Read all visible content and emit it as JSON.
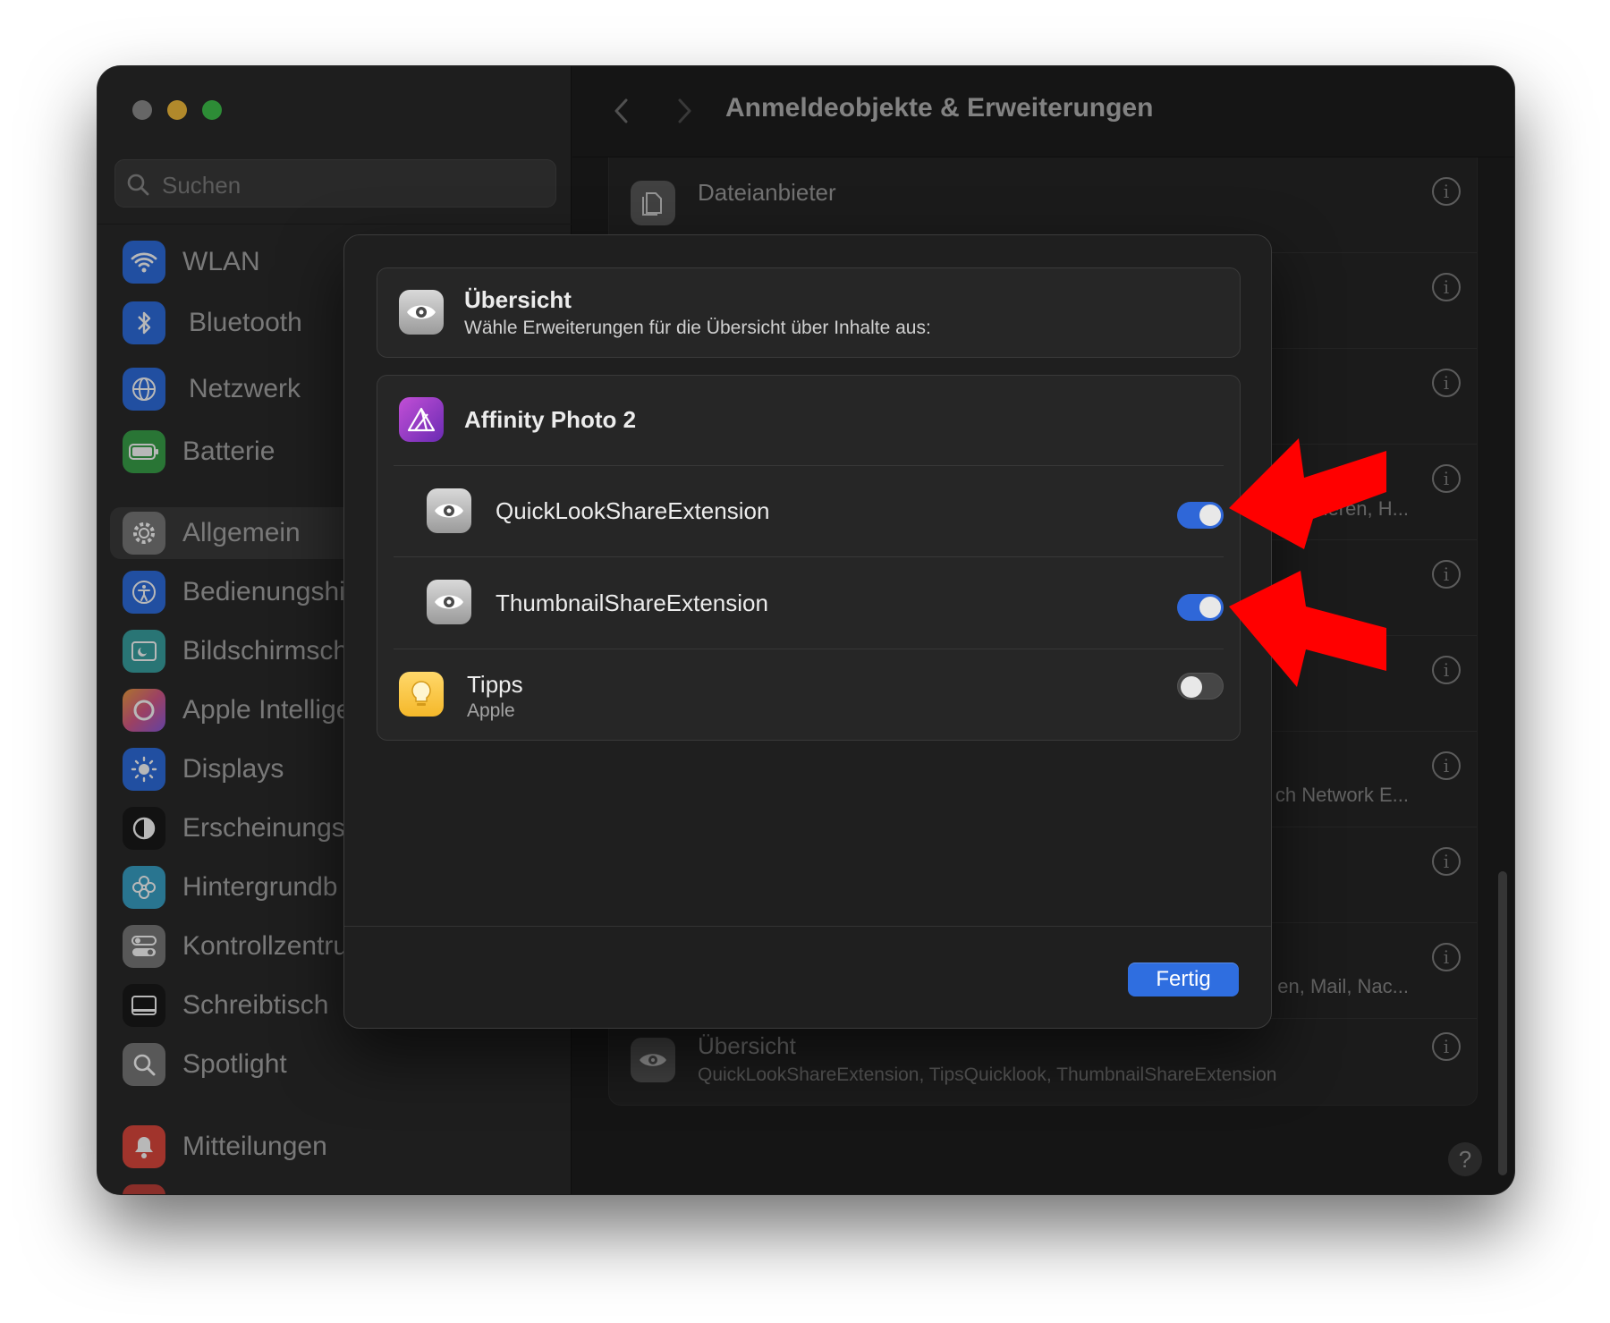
{
  "sidebar": {
    "search_placeholder": "Suchen",
    "items": [
      {
        "label": "WLAN",
        "icon": "wifi-icon",
        "color": "#2f6ee0"
      },
      {
        "label": "Bluetooth",
        "icon": "bluetooth-icon",
        "color": "#2f6ee0"
      },
      {
        "label": "Netzwerk",
        "icon": "globe-icon",
        "color": "#2f6ee0"
      },
      {
        "label": "Batterie",
        "icon": "battery-icon",
        "color": "#3aa34a"
      },
      {
        "label": "Allgemein",
        "icon": "gear-icon",
        "color": "#7a7a7a"
      },
      {
        "label": "Bedienungshi",
        "icon": "accessibility-icon",
        "color": "#2f6ee0"
      },
      {
        "label": "Bildschirmsch",
        "icon": "screensaver-icon",
        "color": "#3aa3a3"
      },
      {
        "label": "Apple Intellige",
        "icon": "apple-intelligence-icon",
        "color": "#d85a8a"
      },
      {
        "label": "Displays",
        "icon": "sun-icon",
        "color": "#2f6ee0"
      },
      {
        "label": "Erscheinungs",
        "icon": "appearance-icon",
        "color": "#1a1a1a"
      },
      {
        "label": "Hintergrundb",
        "icon": "flower-icon",
        "color": "#3aa3c8"
      },
      {
        "label": "Kontrollzentru",
        "icon": "control-center-icon",
        "color": "#7a7a7a"
      },
      {
        "label": "Schreibtisch",
        "icon": "desktop-icon",
        "color": "#1a1a1a"
      },
      {
        "label": "Spotlight",
        "icon": "magnifier-icon",
        "color": "#7a7a7a"
      },
      {
        "label": "Mitteilungen",
        "icon": "bell-icon",
        "color": "#e0483e"
      }
    ]
  },
  "titlebar": {
    "title": "Anmeldeobjekte & Erweiterungen"
  },
  "background_list": {
    "top_row_title": "Dateianbieter",
    "partial_texts": [
      "rtieren, H...",
      "ch Network E...",
      "en, Mail, Nac..."
    ],
    "bottom_row_title": "Übersicht",
    "bottom_row_sub": "QuickLookShareExtension, TipsQuicklook, ThumbnailShareExtension",
    "info_glyph": "i",
    "help_glyph": "?"
  },
  "sheet": {
    "header": {
      "title": "Übersicht",
      "subtitle": "Wähle Erweiterungen für die Übersicht über Inhalte aus:"
    },
    "app": {
      "name": "Affinity Photo 2",
      "extensions": [
        {
          "label": "QuickLookShareExtension",
          "enabled": true
        },
        {
          "label": "ThumbnailShareExtension",
          "enabled": true
        }
      ]
    },
    "tips": {
      "title": "Tipps",
      "subtitle": "Apple",
      "enabled": false
    },
    "done_label": "Fertig"
  },
  "colors": {
    "accent": "#2f6ee0",
    "annotation_arrow": "#ff0000"
  }
}
